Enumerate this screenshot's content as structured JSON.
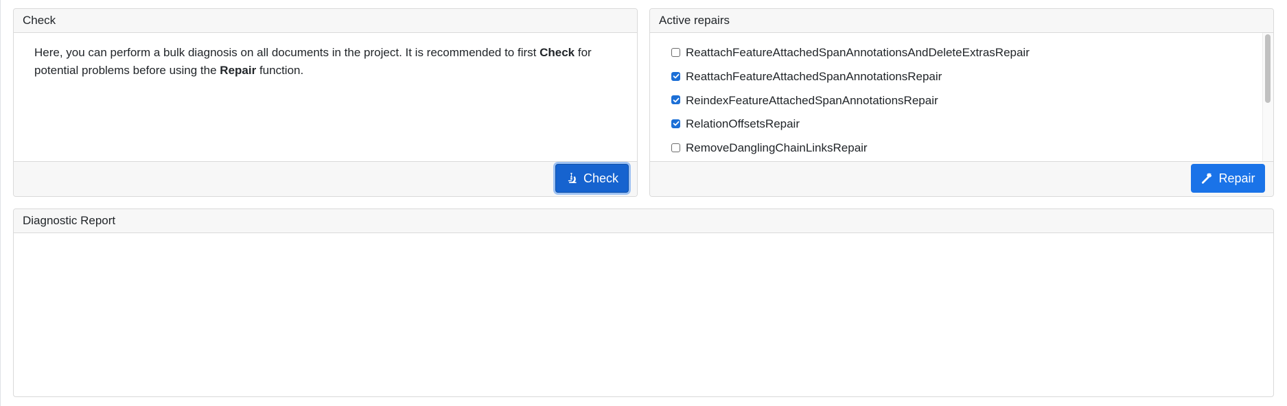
{
  "check_panel": {
    "title": "Check",
    "description": {
      "part1": "Here, you can perform a bulk diagnosis on all documents in the project. It is recommended to first ",
      "bold1": "Check",
      "part2": " for potential problems before using the ",
      "bold2": "Repair",
      "part3": " function."
    },
    "button_label": "Check",
    "button_icon": "microscope-icon"
  },
  "repairs_panel": {
    "title": "Active repairs",
    "items": [
      {
        "label": "ReattachFeatureAttachedSpanAnnotationsAndDeleteExtrasRepair",
        "checked": false
      },
      {
        "label": "ReattachFeatureAttachedSpanAnnotationsRepair",
        "checked": true
      },
      {
        "label": "ReindexFeatureAttachedSpanAnnotationsRepair",
        "checked": true
      },
      {
        "label": "RelationOffsetsRepair",
        "checked": true
      },
      {
        "label": "RemoveDanglingChainLinksRepair",
        "checked": false
      }
    ],
    "button_label": "Repair",
    "button_icon": "hammer-icon"
  },
  "report_panel": {
    "title": "Diagnostic Report",
    "content": ""
  },
  "colors": {
    "primary": "#1a73e8",
    "panel_header_bg": "#f7f7f7",
    "border": "#d9d9d9"
  }
}
